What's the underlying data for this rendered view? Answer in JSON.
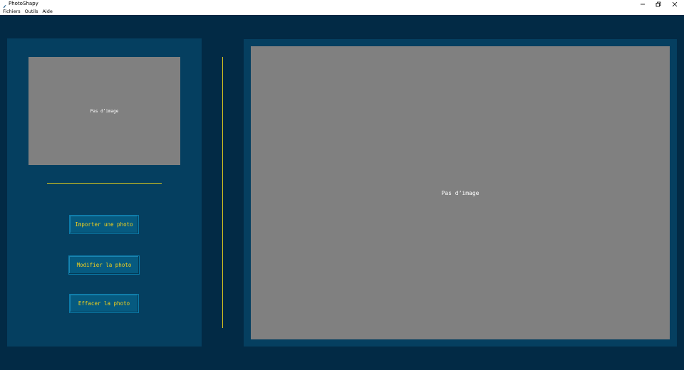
{
  "window": {
    "title": "PhotoShapy",
    "controls": [
      "minimize",
      "restore",
      "close"
    ]
  },
  "menu": {
    "items": [
      "Fichiers",
      "Outils",
      "Aide"
    ]
  },
  "left_panel": {
    "thumbnail_placeholder": "Pas d’image",
    "buttons": {
      "import": "Importer une photo",
      "modify": "Modifier la photo",
      "clear": "Effacer la photo"
    }
  },
  "canvas": {
    "placeholder": "Pas d’image"
  },
  "colors": {
    "background": "#022a45",
    "panel": "#053f60",
    "image_placeholder": "#808080",
    "accent_line": "#d6c61e",
    "button": "#065a80",
    "button_text": "#f2d21b"
  },
  "icons": {
    "app": "feather-icon",
    "minimize": "minimize-icon",
    "restore": "restore-icon",
    "close": "close-icon"
  }
}
